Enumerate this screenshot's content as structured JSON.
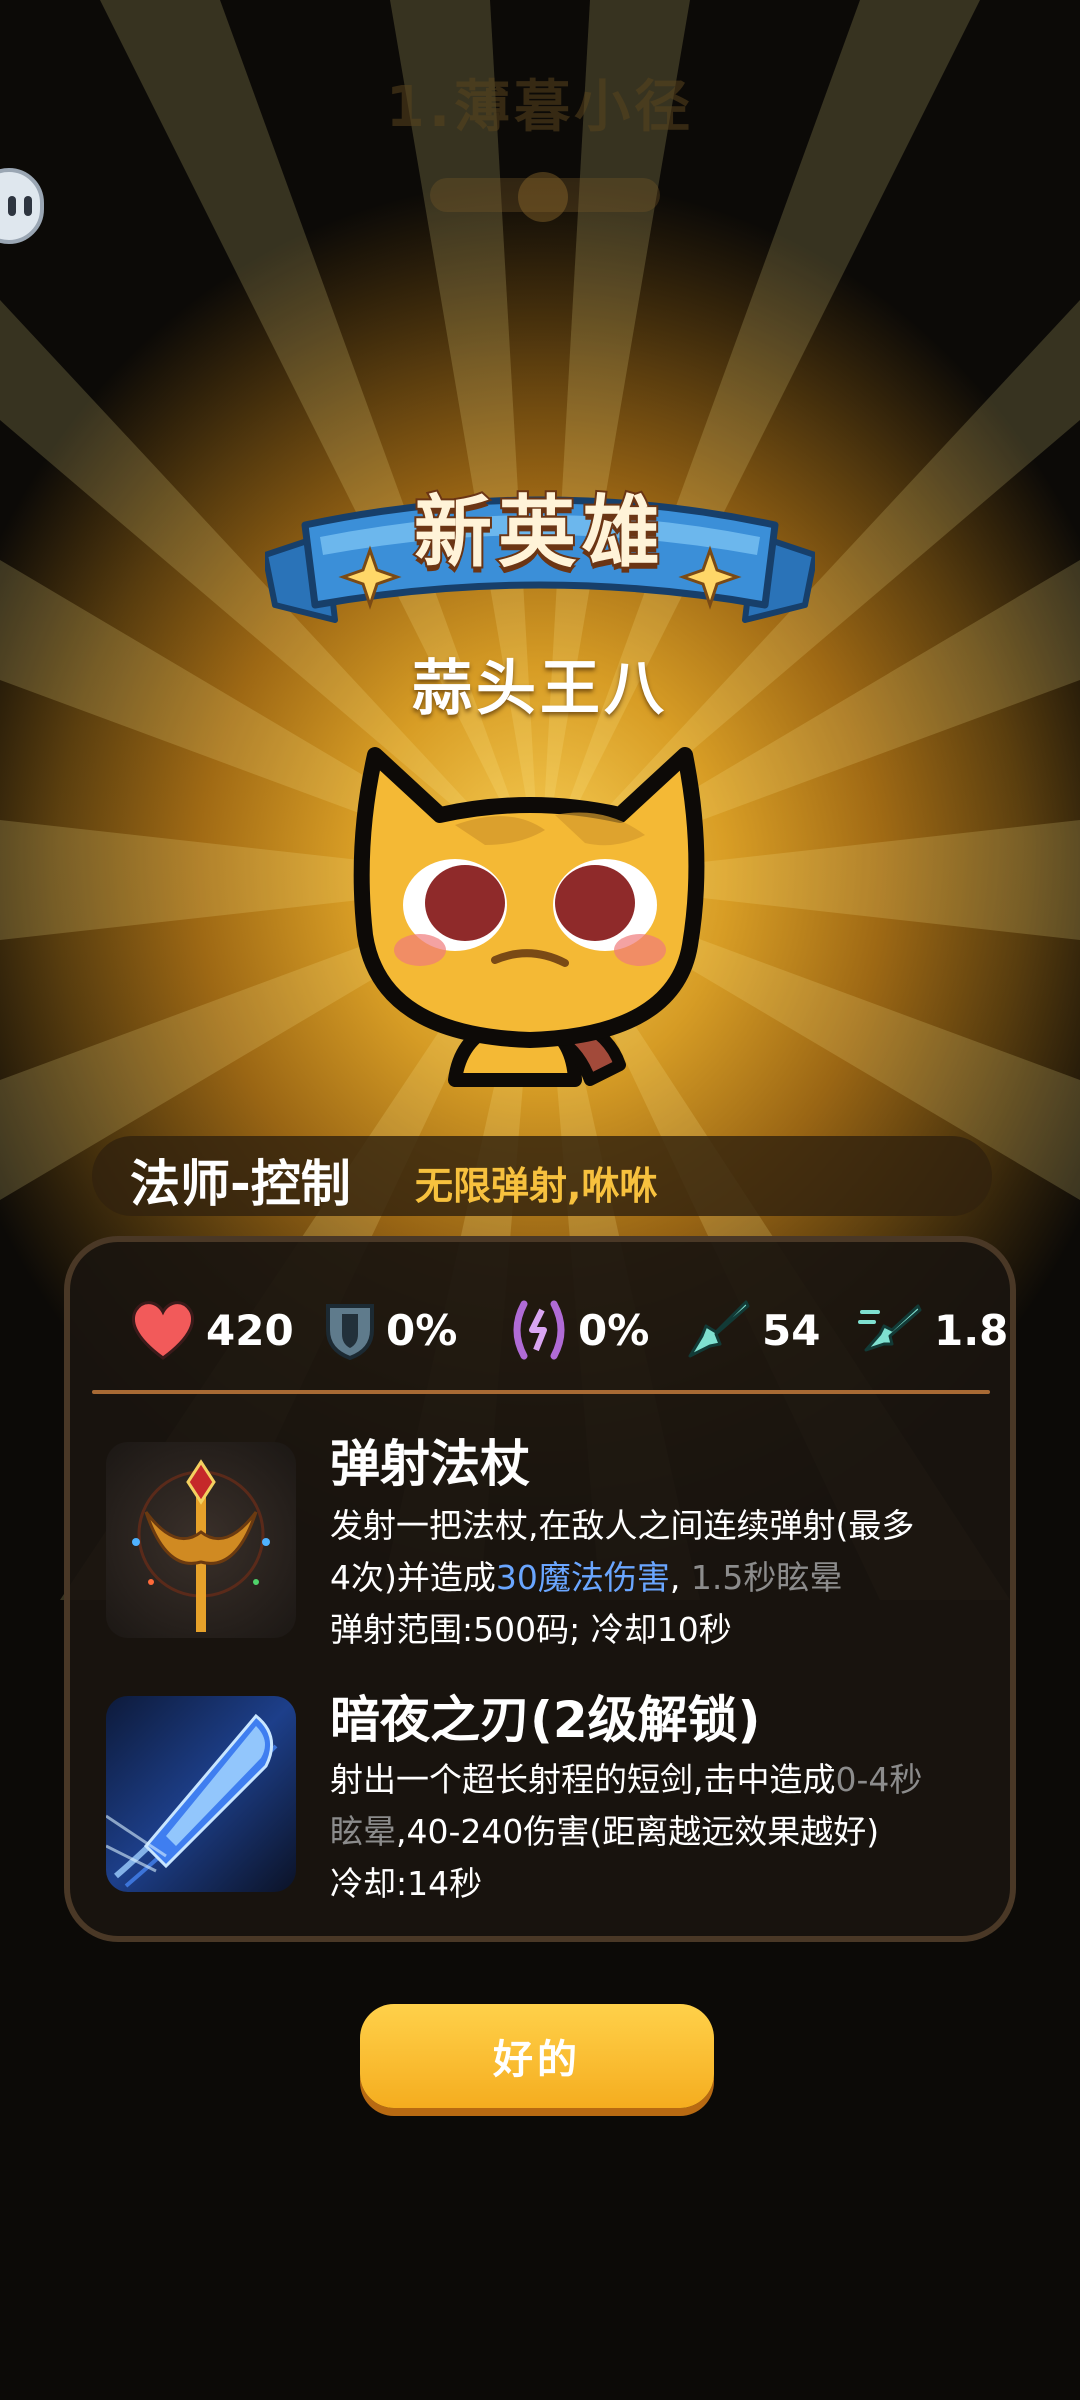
{
  "background": {
    "level_title": "1.薄暮小径"
  },
  "popup": {
    "banner": "新英雄",
    "hero_name": "蒜头王八",
    "class_label": "法师-控制",
    "tagline": "无限弹射,咻咻"
  },
  "stats": [
    {
      "icon": "heart-icon",
      "value": "420",
      "color": "#f25a5a"
    },
    {
      "icon": "armor-shield-icon",
      "value": "0%",
      "color": "#5f7b8c"
    },
    {
      "icon": "magic-resist-icon",
      "value": "0%",
      "color": "#b06bd6"
    },
    {
      "icon": "attack-sword-icon",
      "value": "54",
      "color": "#7fe0d0"
    },
    {
      "icon": "attack-speed-icon",
      "value": "1.8",
      "color": "#7fe0d0"
    }
  ],
  "skills": [
    {
      "icon": "magic-staff-icon",
      "title": "弹射法杖",
      "line1": "发射一把法杖,在敌人之间连续弹射(最多",
      "line2a": "4次)并造成",
      "line2b": "30魔法伤害",
      "line2c": ", ",
      "line2d": "1.5秒眩晕",
      "line3": "弹射范围:500码; 冷却10秒"
    },
    {
      "icon": "night-blade-icon",
      "title": "暗夜之刃(2级解锁)",
      "line1a": "射出一个超长射程的短剑,击中造成",
      "line1b": "0-4秒",
      "line2a": "眩晕",
      "line2b": ",40-240伤害(距离越远效果越好)",
      "line3": "冷却:14秒"
    }
  ],
  "ok_button": "好的",
  "colors": {
    "accent_gold": "#f7c13e",
    "banner_blue": "#3b8fd8",
    "highlight_blue": "#6aa6ff",
    "button_yellow": "#ffc83a"
  }
}
